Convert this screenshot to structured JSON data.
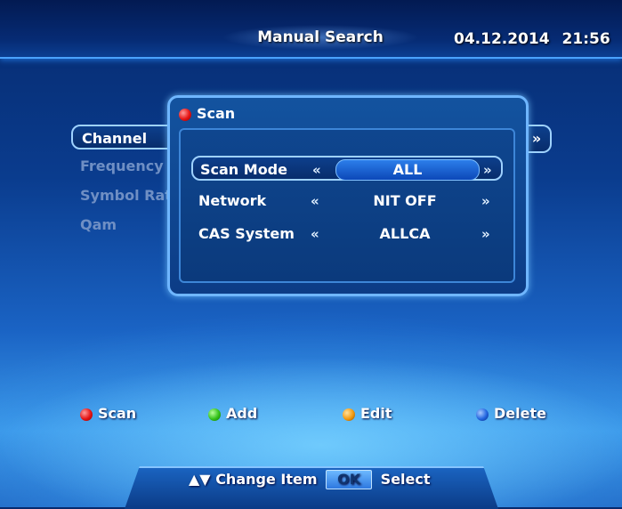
{
  "header": {
    "title": "Manual Search",
    "date": "04.12.2014",
    "time": "21:56"
  },
  "menu": {
    "items": [
      {
        "label": "Channel"
      },
      {
        "label": "Frequency"
      },
      {
        "label": "Symbol Rat"
      },
      {
        "label": "Qam"
      }
    ],
    "arrow": "»"
  },
  "dialog": {
    "title": "Scan",
    "rows": [
      {
        "label": "Scan Mode",
        "value": "ALL",
        "left_arrow": "«",
        "right_arrow": "»"
      },
      {
        "label": "Network",
        "value": "NIT OFF",
        "left_arrow": "«",
        "right_arrow": "»"
      },
      {
        "label": "CAS System",
        "value": "ALLCA",
        "left_arrow": "«",
        "right_arrow": "»"
      }
    ]
  },
  "color_buttons": {
    "red": "Scan",
    "green": "Add",
    "yellow": "Edit",
    "blue": "Delete"
  },
  "footer": {
    "change_label": "Change Item",
    "ok": "OK",
    "select_label": "Select",
    "arrows": "▲▼"
  }
}
